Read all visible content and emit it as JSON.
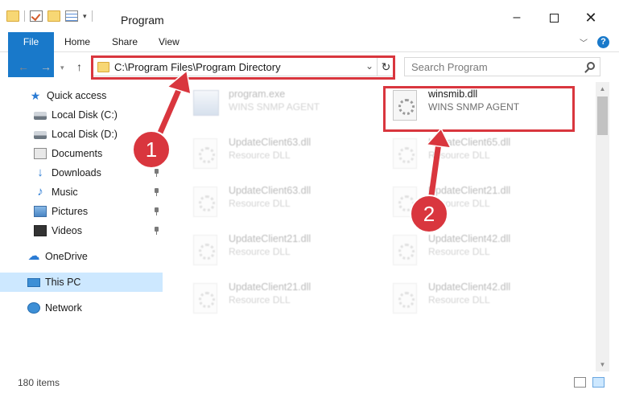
{
  "window": {
    "title": "Program"
  },
  "ribbon": {
    "tabs": [
      "File",
      "Home",
      "Share",
      "View"
    ]
  },
  "address": {
    "path": "C:\\Program Files\\Program Directory"
  },
  "search": {
    "placeholder": "Search Program"
  },
  "sidebar": {
    "items": [
      {
        "label": "Quick access",
        "icon": "star-icon",
        "pinned": false
      },
      {
        "label": "Local Disk (C:)",
        "icon": "disk-icon",
        "pinned": false
      },
      {
        "label": "Local Disk (D:)",
        "icon": "disk-icon",
        "pinned": false
      },
      {
        "label": "Documents",
        "icon": "documents-icon",
        "pinned": false
      },
      {
        "label": "Downloads",
        "icon": "download-icon",
        "pinned": true
      },
      {
        "label": "Music",
        "icon": "music-icon",
        "pinned": true
      },
      {
        "label": "Pictures",
        "icon": "pictures-icon",
        "pinned": true
      },
      {
        "label": "Videos",
        "icon": "videos-icon",
        "pinned": true
      },
      {
        "label": "OneDrive",
        "icon": "onedrive-icon",
        "pinned": false
      },
      {
        "label": "This PC",
        "icon": "pc-icon",
        "pinned": false,
        "selected": true
      },
      {
        "label": "Network",
        "icon": "network-icon",
        "pinned": false
      }
    ]
  },
  "files": [
    {
      "name": "program.exe",
      "desc": "WINS SNMP AGENT",
      "faded": true
    },
    {
      "name": "winsmib.dll",
      "desc": "WINS SNMP AGENT",
      "faded": false,
      "highlighted": true
    },
    {
      "name": "UpdateClient63.dll",
      "desc": "Resource DLL",
      "faded": true
    },
    {
      "name": "UpdateClient65.dll",
      "desc": "Resource DLL",
      "faded": true
    },
    {
      "name": "UpdateClient63.dll",
      "desc": "Resource DLL",
      "faded": true
    },
    {
      "name": "UpdateClient21.dll",
      "desc": "Resource DLL",
      "faded": true
    },
    {
      "name": "UpdateClient21.dll",
      "desc": "Resource DLL",
      "faded": true
    },
    {
      "name": "UpdateClient42.dll",
      "desc": "Resource DLL",
      "faded": true
    },
    {
      "name": "UpdateClient21.dll",
      "desc": "Resource DLL",
      "faded": true
    },
    {
      "name": "UpdateClient42.dll",
      "desc": "Resource DLL",
      "faded": true
    }
  ],
  "status": {
    "item_count": "180 items"
  },
  "callouts": {
    "one": "1",
    "two": "2"
  },
  "colors": {
    "accent": "#1979ca",
    "highlight": "#d9363e",
    "selected_bg": "#cde8ff"
  }
}
